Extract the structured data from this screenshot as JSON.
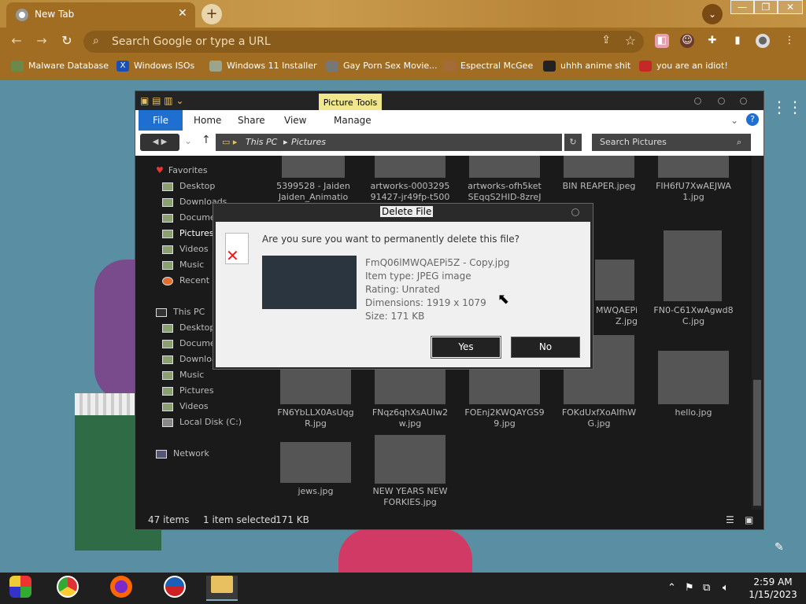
{
  "browser": {
    "tab_title": "New Tab",
    "tab_close": "✕",
    "new_tab": "+",
    "tab_menu": "⌄",
    "window_min": "—",
    "window_max": "❐",
    "window_close": "✕",
    "omnibox_placeholder": "Search Google or type a URL",
    "bookmarks": [
      {
        "label": "Malware Database",
        "icon": "bookmark-malware-icon",
        "color": "#6b8a4a"
      },
      {
        "label": "Windows ISOs",
        "icon": "bookmark-x-icon",
        "color": "#1a4fb5"
      },
      {
        "label": "Windows 11 Installer",
        "icon": "bookmark-image-icon",
        "color": "#9aa58c"
      },
      {
        "label": "Gay Porn Sex Movie...",
        "icon": "bookmark-box-icon",
        "color": "#777"
      },
      {
        "label": "Espectral McGee",
        "icon": "bookmark-face-icon",
        "color": "#a56a3a"
      },
      {
        "label": "uhhh anime shit",
        "icon": "bookmark-anime-icon",
        "color": "#222"
      },
      {
        "label": "you are an idiot!",
        "icon": "bookmark-flag-icon",
        "color": "#c62828"
      }
    ]
  },
  "explorer": {
    "ribbon_context": "Picture Tools",
    "ribbon_tabs": [
      "File",
      "Home",
      "Share",
      "View",
      "Manage"
    ],
    "address_parts": [
      "This PC",
      "Pictures"
    ],
    "search_placeholder": "Search Pictures",
    "nav": {
      "favorites_header": "Favorites",
      "favorites": [
        "Desktop",
        "Downloads",
        "Documents",
        "Pictures",
        "Videos",
        "Music",
        "Recent places"
      ],
      "thispc_header": "This PC",
      "thispc": [
        "Desktop",
        "Documents",
        "Downloads",
        "Music",
        "Pictures",
        "Videos",
        "Local Disk (C:)"
      ],
      "network": "Network"
    },
    "files_row1": [
      {
        "name": "5399528 - Jaiden Jaiden_Animatio",
        "color": "#f2f2f2"
      },
      {
        "name": "artworks-0003295 91427-jr49fp-t500",
        "color": "#7a6a45"
      },
      {
        "name": "artworks-ofh5ket SEqqS2HID-8zreJ",
        "color": "#4a4a4a"
      },
      {
        "name": "BIN REAPER.jpeg",
        "color": "#6a6a6a"
      },
      {
        "name": "FIH6fU7XwAEJWA 1.jpg",
        "color": "#b56a2a"
      }
    ],
    "files_row2_right": [
      {
        "name": "MWQAEPi Z.jpg",
        "color": "#3a3a3a"
      },
      {
        "name": "FN0-C61XwAgwd8 C.jpg",
        "color": "#6a4a2a"
      }
    ],
    "files_row3": [
      {
        "name": "FN6YbLLX0AsUqg R.jpg",
        "color": "#2a3a7a"
      },
      {
        "name": "FNqz6qhXsAUIw2 w.jpg",
        "color": "#3a3a3a"
      },
      {
        "name": "FOEnj2KWQAYGS9 9.jpg",
        "color": "#3a4a5a"
      },
      {
        "name": "FOKdUxfXoAIfhW G.jpg",
        "color": "#8a3a3a"
      },
      {
        "name": "hello.jpg",
        "color": "#b58a7a"
      }
    ],
    "files_row4": [
      {
        "name": "jews.jpg",
        "color": "#c8d8e8"
      },
      {
        "name": "NEW YEARS NEW FORKIES.jpg",
        "color": "#2a2a2a"
      }
    ],
    "status_items": "47 items",
    "status_selected": "1 item selected",
    "status_size": "171 KB"
  },
  "dialog": {
    "title": "Delete File",
    "question": "Are you sure you want to permanently delete this file?",
    "file_name": "FmQ06lMWQAEPi5Z - Copy.jpg",
    "item_type": "Item type: JPEG image",
    "rating": "Rating: Unrated",
    "dimensions": "Dimensions: 1919 x 1079",
    "size": "Size: 171 KB",
    "yes_label": "Yes",
    "no_label": "No"
  },
  "taskbar": {
    "time": "2:59 AM",
    "date": "1/15/2023"
  },
  "colors": {
    "chrome_bg": "#a06d22",
    "accent_blue": "#1e6fd0",
    "picture_tools": "#f0e68c"
  }
}
